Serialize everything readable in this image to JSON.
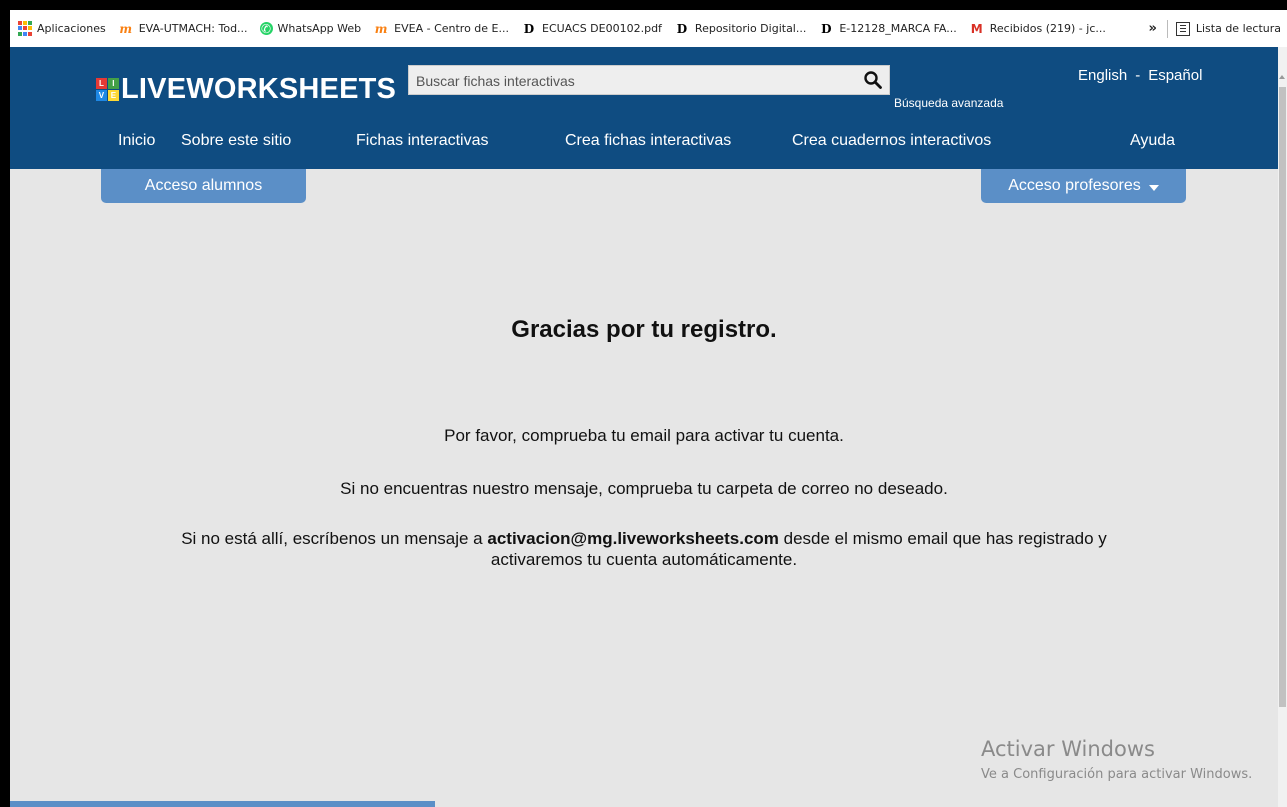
{
  "bookmarks": [
    {
      "label": "Aplicaciones",
      "icon": "apps-grid-icon"
    },
    {
      "label": "EVA-UTMACH: Tod...",
      "icon": "moodle-icon"
    },
    {
      "label": "WhatsApp Web",
      "icon": "whatsapp-icon"
    },
    {
      "label": "EVEA - Centro de E...",
      "icon": "moodle-icon"
    },
    {
      "label": "ECUACS DE00102.pdf",
      "icon": "dspace-icon"
    },
    {
      "label": "Repositorio Digital...",
      "icon": "dspace-icon"
    },
    {
      "label": "E-12128_MARCA FA...",
      "icon": "dspace-icon"
    },
    {
      "label": "Recibidos (219) - jc...",
      "icon": "gmail-icon"
    }
  ],
  "bookmarks_more": "»",
  "reading_list": "Lista de lectura",
  "header": {
    "logo_text": "LIVEWORKSHEETS",
    "logo_mark": [
      "L",
      "I",
      "V",
      "E"
    ],
    "search_placeholder": "Buscar fichas interactivas",
    "advanced_search": "Búsqueda avanzada",
    "lang_english": "English",
    "lang_sep": "-",
    "lang_spanish": "Español",
    "brand_color": "#0f4c81"
  },
  "nav": [
    "Inicio",
    "Sobre este sitio",
    "Fichas interactivas",
    "Crea fichas interactivas",
    "Crea cuadernos interactivos",
    "Ayuda"
  ],
  "access": {
    "students": "Acceso alumnos",
    "teachers": "Acceso profesores"
  },
  "content": {
    "title": "Gracias por tu registro.",
    "msg1": "Por favor, comprueba tu email para activar tu cuenta.",
    "msg2": "Si no encuentras nuestro mensaje, comprueba tu carpeta de correo no deseado.",
    "msg3_pre": "Si no está allí, escríbenos un mensaje a ",
    "msg3_email": "activacion@mg.liveworksheets.com",
    "msg3_post": " desde el mismo email que has registrado y",
    "msg3_line2": "activaremos tu cuenta automáticamente."
  },
  "watermark": {
    "title": "Activar Windows",
    "subtitle": "Ve a Configuración para activar Windows."
  }
}
